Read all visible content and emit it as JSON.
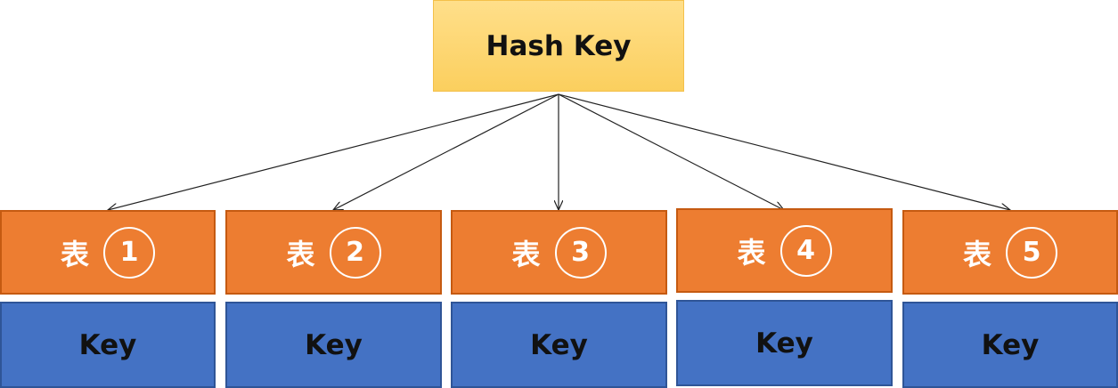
{
  "diagram": {
    "hash_key": "Hash Key",
    "tables": [
      {
        "label": "表",
        "number": "1",
        "key": "Key"
      },
      {
        "label": "表",
        "number": "2",
        "key": "Key"
      },
      {
        "label": "表",
        "number": "3",
        "key": "Key"
      },
      {
        "label": "表",
        "number": "4",
        "key": "Key"
      },
      {
        "label": "表",
        "number": "5",
        "key": "Key"
      }
    ]
  },
  "colors": {
    "hash_key_fill": "#fbcf5e",
    "table_fill": "#ed7d31",
    "key_fill": "#4472c4"
  }
}
